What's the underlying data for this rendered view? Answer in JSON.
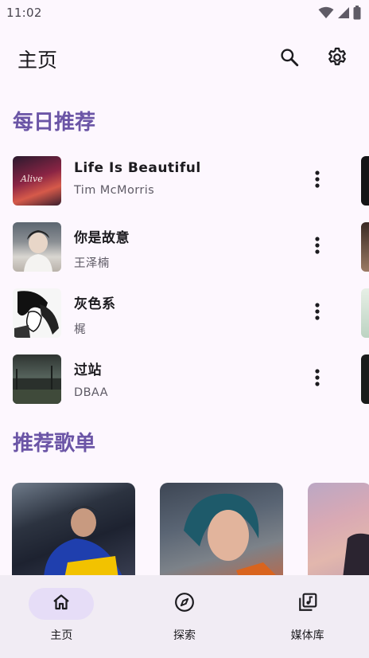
{
  "status_bar": {
    "time": "11:02",
    "icons": [
      "wifi-icon",
      "cellular-icon",
      "battery-icon"
    ]
  },
  "app_bar": {
    "title": "主页",
    "actions": [
      "search-icon",
      "settings-icon"
    ]
  },
  "daily_recommend": {
    "heading": "每日推荐",
    "songs": [
      {
        "title": "Life Is Beautiful",
        "artist": "Tim McMorris",
        "cover_text": "Alive"
      },
      {
        "title": "你是故意",
        "artist": "王泽楠"
      },
      {
        "title": "灰色系",
        "artist": "梶"
      },
      {
        "title": "过站",
        "artist": "DBAA"
      }
    ]
  },
  "recommended_playlists": {
    "heading": "推荐歌单",
    "count_visible": 3
  },
  "bottom_nav": {
    "items": [
      {
        "label": "主页",
        "icon": "home-icon",
        "active": true
      },
      {
        "label": "探索",
        "icon": "compass-icon",
        "active": false
      },
      {
        "label": "媒体库",
        "icon": "library-icon",
        "active": false
      }
    ]
  },
  "colors": {
    "background": "#fdf7fe",
    "accent": "#6b55a6",
    "nav_background": "#f1ecf4",
    "nav_active_pill": "#e6ddf7"
  }
}
